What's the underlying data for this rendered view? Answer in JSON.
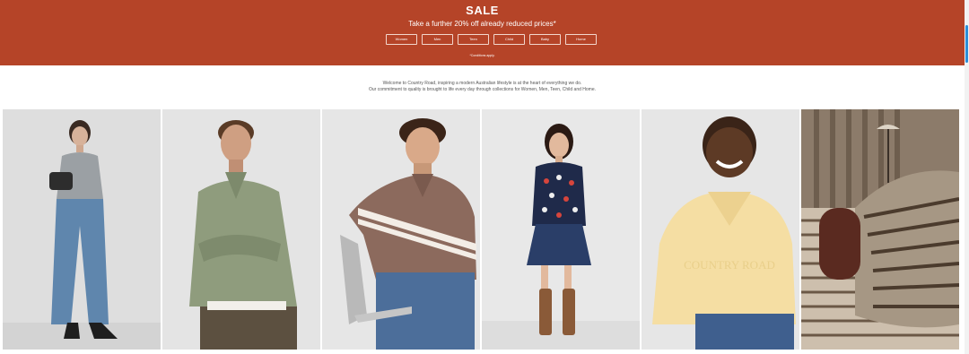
{
  "banner": {
    "title": "SALE",
    "subtitle": "Take a further 20% off already reduced prices*",
    "buttons": [
      "Women",
      "Men",
      "Teen",
      "Child",
      "Baby",
      "Home"
    ],
    "conditions": "*Conditions apply.",
    "background": "#b54428"
  },
  "intro": {
    "line1": "Welcome to Country Road, inspiring a modern Australian lifestyle is at the heart of everything we do.",
    "line2": "Our commitment to quality is brought to life every day through collections for Women, Men, Teen, Child and Home."
  },
  "tiles": [
    {
      "name": "women"
    },
    {
      "name": "men"
    },
    {
      "name": "teen"
    },
    {
      "name": "child"
    },
    {
      "name": "baby",
      "sweater_text": "COUNTRY ROAD"
    },
    {
      "name": "home"
    }
  ],
  "icons": {
    "scrollbar": "scrollbar-thumb"
  }
}
